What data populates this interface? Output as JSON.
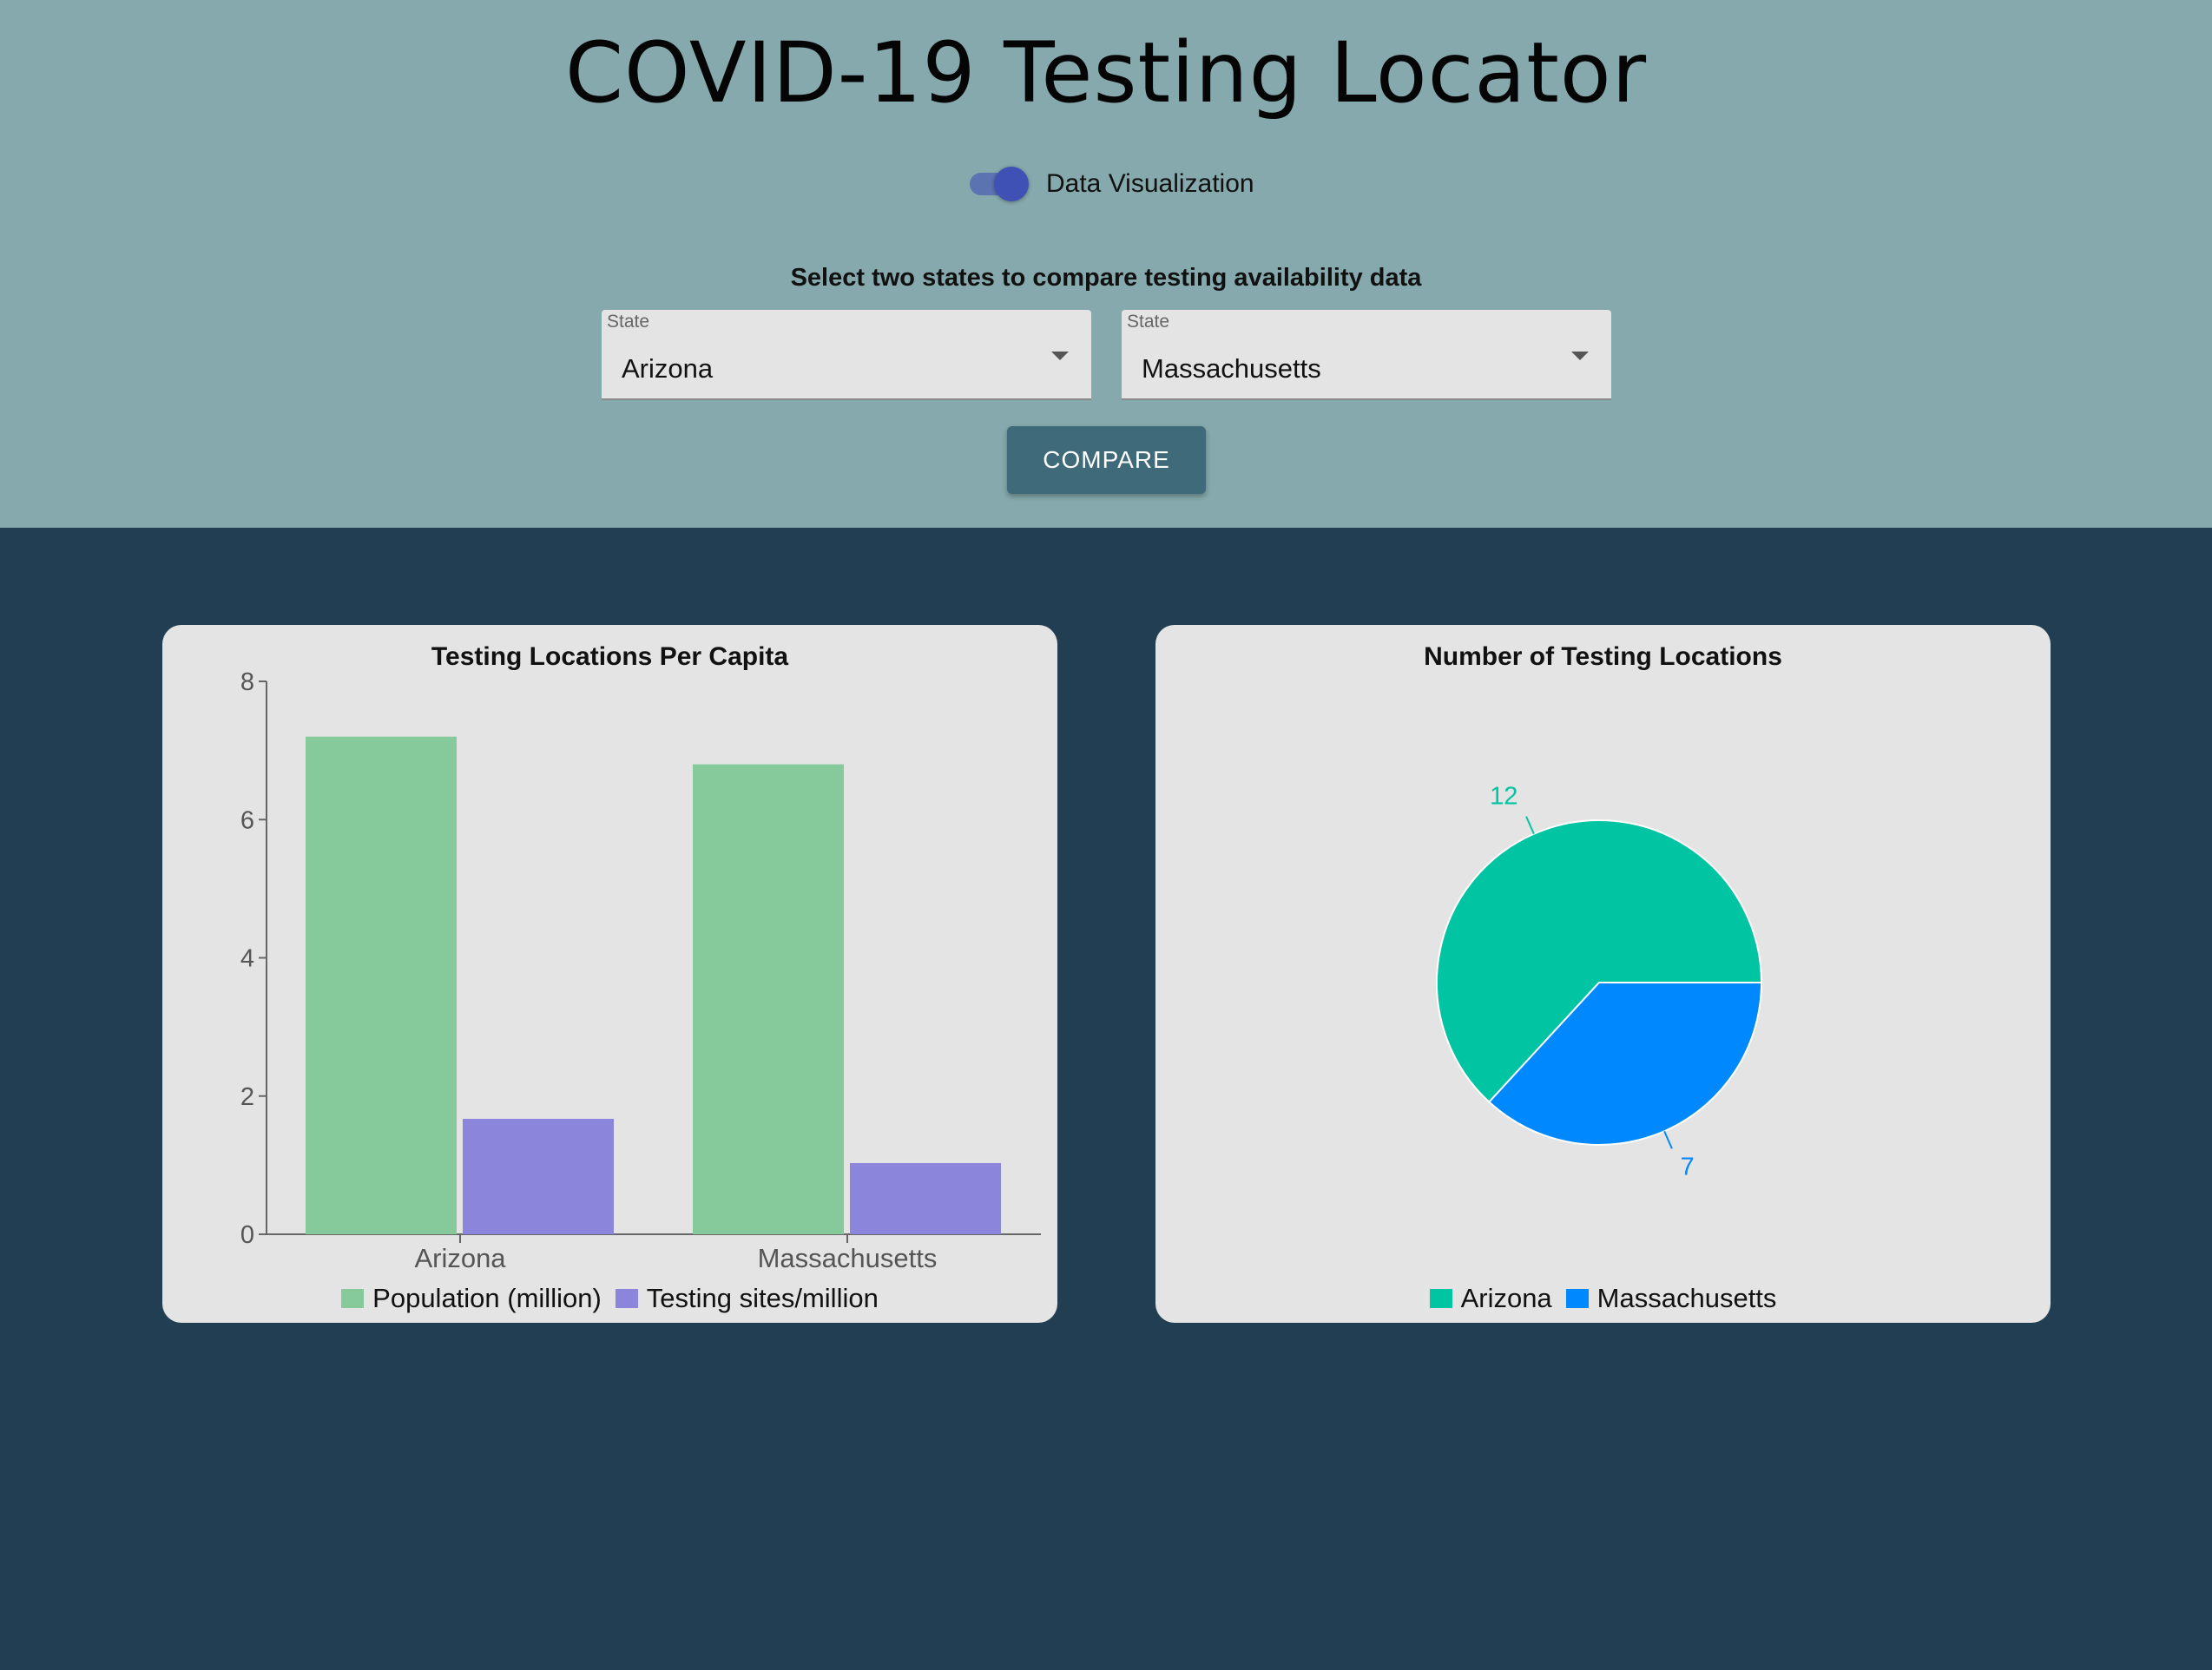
{
  "header": {
    "title": "COVID-19 Testing Locator",
    "toggle": {
      "label": "Data Visualization",
      "checked": true
    },
    "instruction": "Select two states to compare testing availability data",
    "selects": [
      {
        "label": "State",
        "value": "Arizona"
      },
      {
        "label": "State",
        "value": "Massachusetts"
      }
    ],
    "compare_label": "COMPARE"
  },
  "colors": {
    "population": "#86ca9c",
    "testing": "#8b86db",
    "arizona": "#00c4a2",
    "massachusetts": "#0088fe"
  },
  "chart_data": [
    {
      "type": "bar",
      "title": "Testing Locations Per Capita",
      "categories": [
        "Arizona",
        "Massachusetts"
      ],
      "series": [
        {
          "name": "Population (million)",
          "values": [
            7.2,
            6.8
          ]
        },
        {
          "name": "Testing sites/million",
          "values": [
            1.67,
            1.03
          ]
        }
      ],
      "ylim": [
        0,
        8
      ],
      "yticks": [
        0,
        2,
        4,
        6,
        8
      ],
      "xlabel": "",
      "ylabel": "",
      "legend": "bottom"
    },
    {
      "type": "pie",
      "title": "Number of Testing Locations",
      "labels": [
        "Arizona",
        "Massachusetts"
      ],
      "values": [
        12,
        7
      ],
      "legend": "bottom"
    }
  ]
}
